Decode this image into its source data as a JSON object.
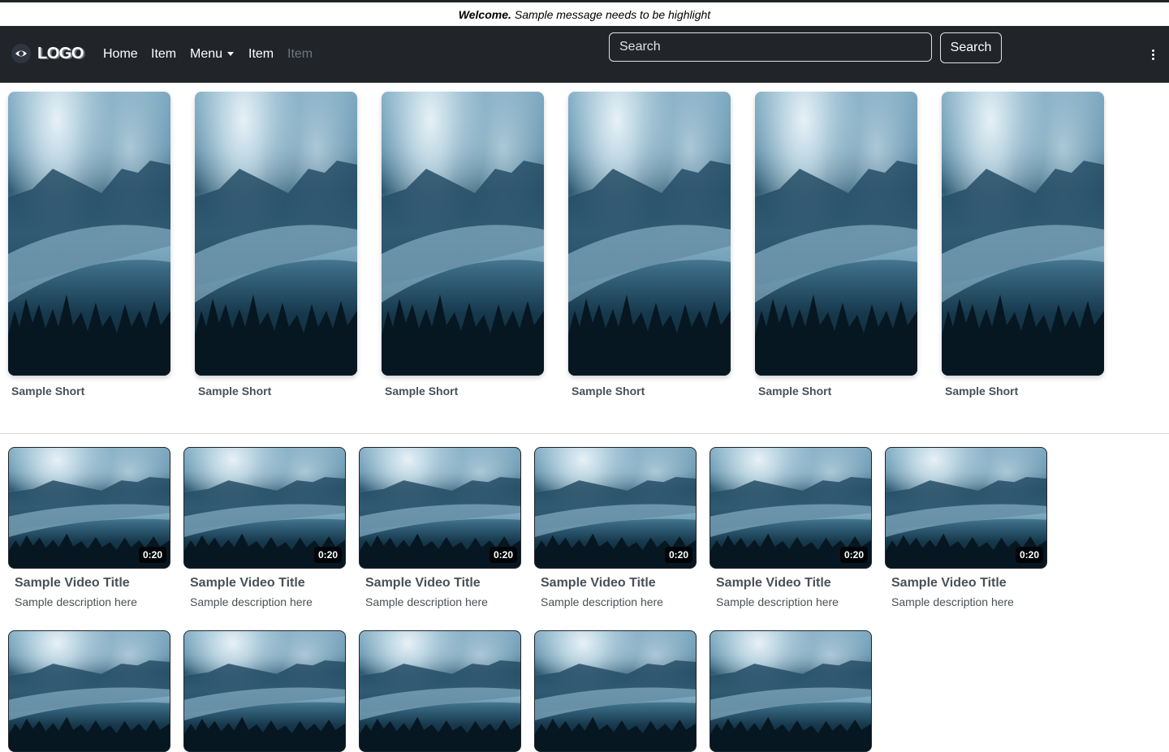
{
  "announcement": {
    "strong": "Welcome.",
    "message": "Sample message needs to be highlight"
  },
  "navbar": {
    "brand": "LOGO",
    "links": [
      "Home",
      "Item",
      "Menu",
      "Item",
      "Item"
    ],
    "search": {
      "placeholder": "Search",
      "button": "Search"
    },
    "more_icon": "vertical-ellipsis-icon"
  },
  "shorts": [
    {
      "title": "Sample Short"
    },
    {
      "title": "Sample Short"
    },
    {
      "title": "Sample Short"
    },
    {
      "title": "Sample Short"
    },
    {
      "title": "Sample Short"
    },
    {
      "title": "Sample Short"
    }
  ],
  "videos": [
    {
      "title": "Sample Video Title",
      "description": "Sample description here",
      "duration": "0:20"
    },
    {
      "title": "Sample Video Title",
      "description": "Sample description here",
      "duration": "0:20"
    },
    {
      "title": "Sample Video Title",
      "description": "Sample description here",
      "duration": "0:20"
    },
    {
      "title": "Sample Video Title",
      "description": "Sample description here",
      "duration": "0:20"
    },
    {
      "title": "Sample Video Title",
      "description": "Sample description here",
      "duration": "0:20"
    },
    {
      "title": "Sample Video Title",
      "description": "Sample description here",
      "duration": "0:20"
    }
  ],
  "colors": {
    "navbar_bg": "#212529",
    "text_muted": "#495057",
    "disabled_link": "#6c757d"
  }
}
